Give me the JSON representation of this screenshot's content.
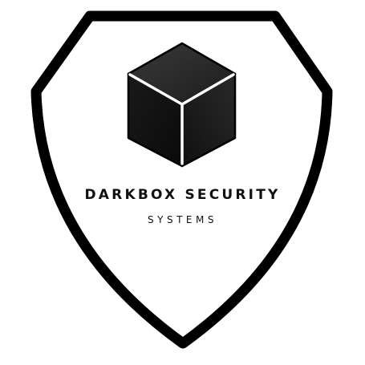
{
  "logo": {
    "name": "DARKBOX SECURITY",
    "subtitle": "SYSTEMS",
    "icon": "cube-icon",
    "emblem": "shield-icon",
    "colors": {
      "background": "#ffffff",
      "outline": "#000000",
      "cube_top": "#2b2b2b",
      "cube_left": "#141414",
      "cube_right": "#1e1e1e",
      "cube_edge": "#ffffff",
      "text": "#111111"
    }
  }
}
